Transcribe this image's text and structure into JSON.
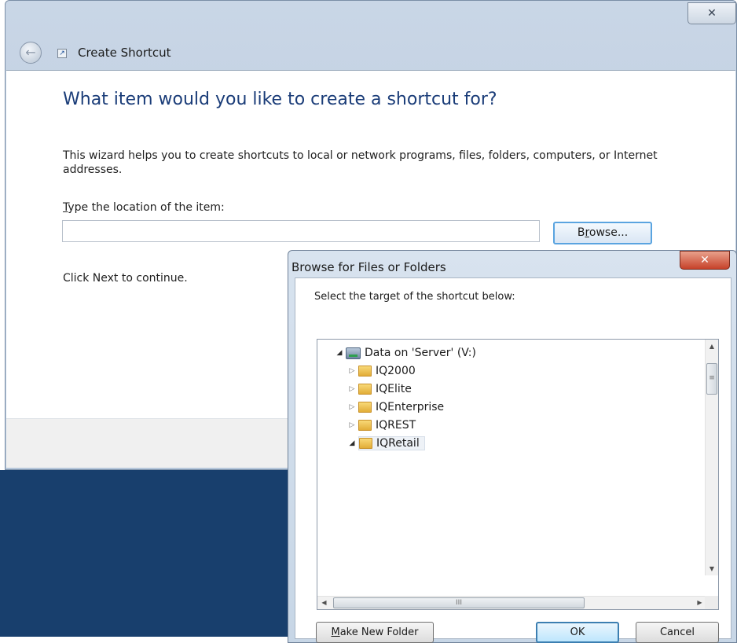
{
  "wizard": {
    "title": "Create Shortcut",
    "close_glyph": "✕",
    "back_glyph": "←",
    "heading": "What item would you like to create a shortcut for?",
    "description": "This wizard helps you to create shortcuts to local or network programs, files, folders, computers, or Internet addresses.",
    "location_label": "Type the location of the item:",
    "location_value": "",
    "browse_label": "Browse...",
    "click_next": "Click Next to continue."
  },
  "browse_dialog": {
    "title": "Browse for Files or Folders",
    "close_glyph": "✕",
    "instruction": "Select the target of the shortcut below:",
    "tree": {
      "root": {
        "label": "Data on 'Server' (V:)",
        "icon": "network-drive-icon",
        "expanded": true
      },
      "items": [
        {
          "label": "IQ2000",
          "icon": "folder-icon",
          "expanded": false
        },
        {
          "label": "IQElite",
          "icon": "folder-icon",
          "expanded": false
        },
        {
          "label": "IQEnterprise",
          "icon": "folder-icon",
          "expanded": false
        },
        {
          "label": "IQREST",
          "icon": "folder-icon",
          "expanded": false
        },
        {
          "label": "IQRetail",
          "icon": "folder-icon",
          "expanded": true,
          "selected": true
        }
      ]
    },
    "make_new_folder_label": "Make New Folder",
    "ok_label": "OK",
    "cancel_label": "Cancel"
  },
  "colors": {
    "heading": "#1a3c78",
    "desktop": "#183f6d",
    "dialog_close": "#c7422a",
    "default_button_border": "#3c7fb1"
  }
}
